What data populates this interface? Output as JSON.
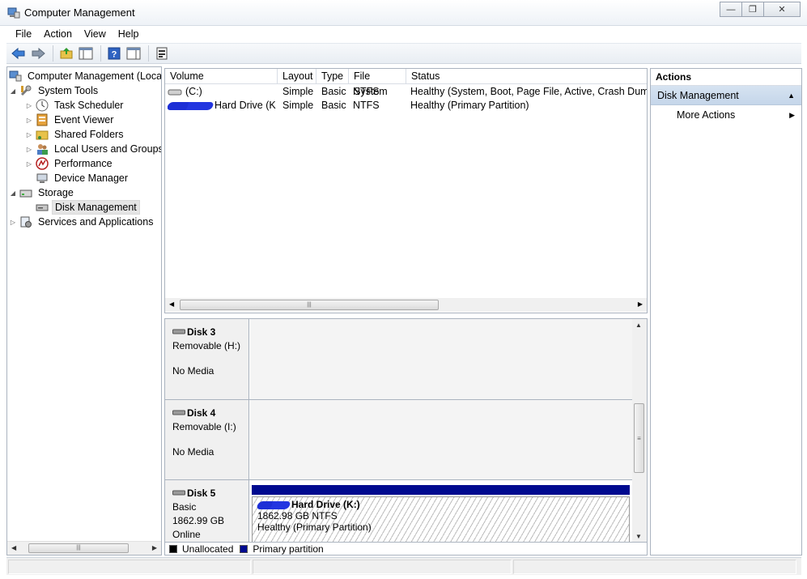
{
  "window": {
    "title": "Computer Management"
  },
  "menu": [
    "File",
    "Action",
    "View",
    "Help"
  ],
  "tree": {
    "root": "Computer Management (Local)",
    "system_tools": "System Tools",
    "task_scheduler": "Task Scheduler",
    "event_viewer": "Event Viewer",
    "shared_folders": "Shared Folders",
    "local_users": "Local Users and Groups",
    "performance": "Performance",
    "device_manager": "Device Manager",
    "storage": "Storage",
    "disk_management": "Disk Management",
    "services": "Services and Applications"
  },
  "volumes": {
    "columns": [
      "Volume",
      "Layout",
      "Type",
      "File System",
      "Status"
    ],
    "rows": [
      {
        "volume": "(C:)",
        "layout": "Simple",
        "type": "Basic",
        "fs": "NTFS",
        "status": "Healthy (System, Boot, Page File, Active, Crash Dump, P"
      },
      {
        "volume": "Hard Drive (K:)",
        "layout": "Simple",
        "type": "Basic",
        "fs": "NTFS",
        "status": "Healthy (Primary Partition)"
      }
    ]
  },
  "disks": [
    {
      "name": "Disk 3",
      "line1": "Removable (H:)",
      "line2": "No Media"
    },
    {
      "name": "Disk 4",
      "line1": "Removable (I:)",
      "line2": "No Media"
    },
    {
      "name": "Disk 5",
      "line1": "Basic",
      "line2": "1862.99 GB",
      "line3": "Online",
      "partition": {
        "name": "Hard Drive  (K:)",
        "size": "1862.98 GB NTFS",
        "status": "Healthy (Primary Partition)"
      }
    }
  ],
  "legend": [
    {
      "label": "Unallocated",
      "color": "#000000"
    },
    {
      "label": "Primary partition",
      "color": "#000a8f"
    }
  ],
  "actions": {
    "header": "Actions",
    "section": "Disk Management",
    "more": "More Actions"
  },
  "colors": {
    "accent_header": "#c5d6ea",
    "primary_partition": "#000a8f"
  }
}
